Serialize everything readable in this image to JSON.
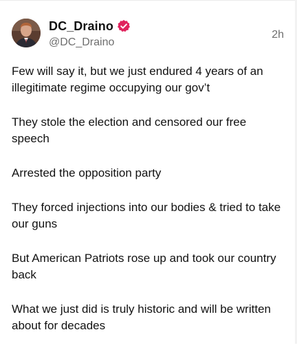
{
  "post": {
    "author": {
      "display_name": "DC_Draino",
      "handle": "@DC_Draino",
      "verified": true,
      "verified_icon": "verified-badge-icon",
      "verified_color": "#e0245e"
    },
    "timestamp": "2h",
    "paragraphs": [
      "Few will say it, but we just endured 4 years of an illegitimate regime occupying our gov’t",
      "They stole the election and censored our free speech",
      "Arrested the opposition party",
      "They forced injections into our bodies & tried to take our guns",
      "But American Patriots rose up and took our country back",
      "What we just did is truly historic and will be written about for decades"
    ]
  }
}
